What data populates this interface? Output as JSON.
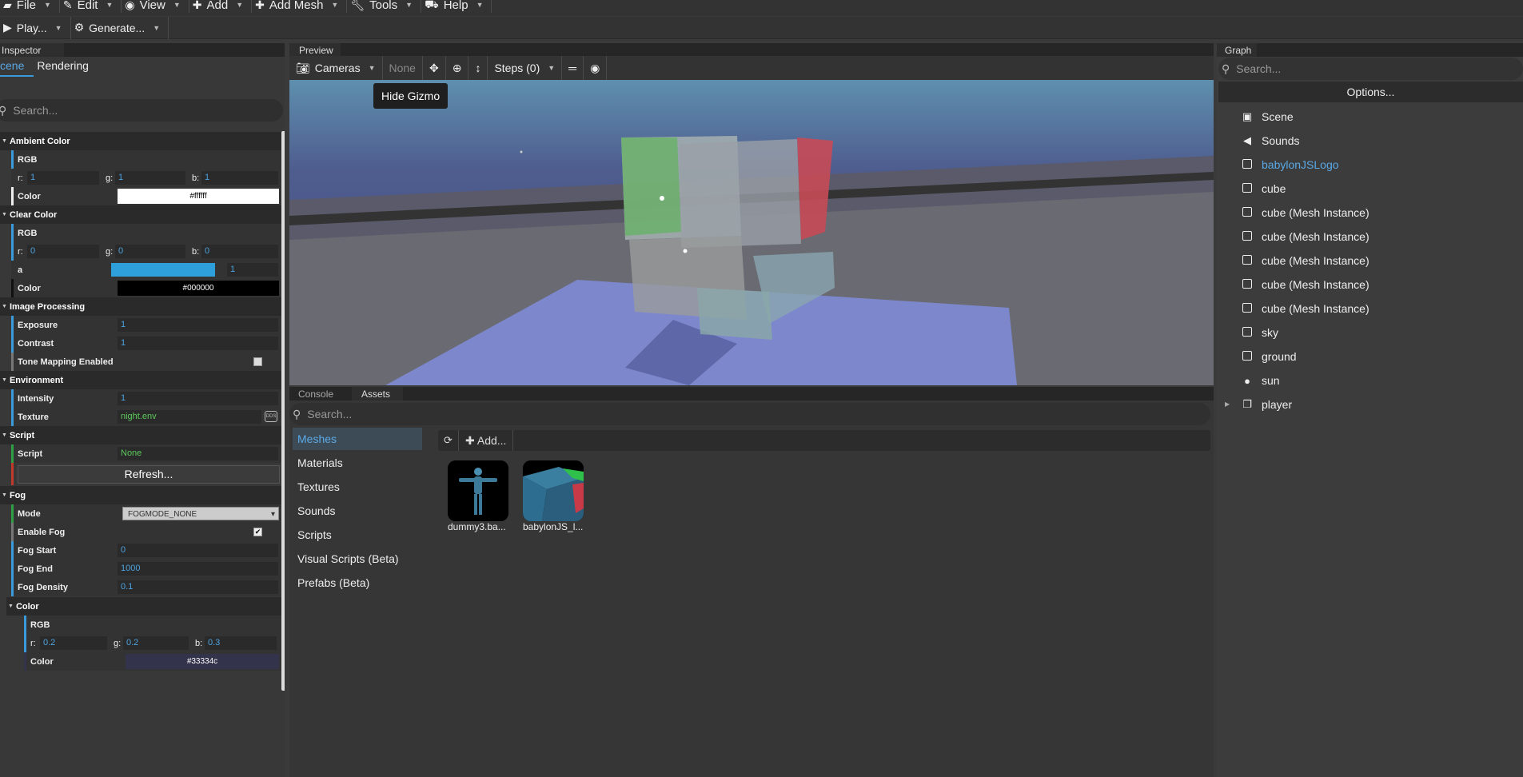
{
  "menubar": {
    "items": [
      {
        "label": "File",
        "icon": "folder-icon"
      },
      {
        "label": "Edit",
        "icon": "edit-icon"
      },
      {
        "label": "View",
        "icon": "eye-icon"
      },
      {
        "label": "Add",
        "icon": "plus-icon"
      },
      {
        "label": "Add Mesh",
        "icon": "plus-icon"
      },
      {
        "label": "Tools",
        "icon": "wrench-icon"
      },
      {
        "label": "Help",
        "icon": "help-icon"
      }
    ]
  },
  "toolbar": {
    "play_label": "Play...",
    "generate_label": "Generate..."
  },
  "inspector": {
    "tab_label": "Inspector",
    "tabs": [
      "cene",
      "Rendering"
    ],
    "search_placeholder": "Search...",
    "ambient": {
      "section": "Ambient Color",
      "rgb_label": "RGB",
      "r": "1",
      "g": "1",
      "b": "1",
      "color_label": "Color",
      "color_hex": "#ffffff"
    },
    "clear": {
      "section": "Clear Color",
      "rgb_label": "RGB",
      "r": "0",
      "g": "0",
      "b": "0",
      "a_label": "a",
      "a_value": "1",
      "color_label": "Color",
      "color_hex": "#000000"
    },
    "image_processing": {
      "section": "Image Processing",
      "exposure_label": "Exposure",
      "exposure": "1",
      "contrast_label": "Contrast",
      "contrast": "1",
      "tone_label": "Tone Mapping Enabled"
    },
    "environment": {
      "section": "Environment",
      "intensity_label": "Intensity",
      "intensity": "1",
      "texture_label": "Texture",
      "texture": "night.env"
    },
    "script": {
      "section": "Script",
      "script_label": "Script",
      "script_value": "None",
      "refresh_label": "Refresh..."
    },
    "fog": {
      "section": "Fog",
      "mode_label": "Mode",
      "mode_value": "FOGMODE_NONE",
      "enable_label": "Enable Fog",
      "start_label": "Fog Start",
      "start": "0",
      "end_label": "Fog End",
      "end": "1000",
      "density_label": "Fog Density",
      "density": "0.1",
      "color_section": "Color",
      "rgb_label": "RGB",
      "r": "0.2",
      "g": "0.2",
      "b": "0.3",
      "color_label": "Color",
      "color_hex": "#33334c"
    },
    "rgb_keys": {
      "r": "r:",
      "g": "g:",
      "b": "b:"
    }
  },
  "preview": {
    "tab_label": "Preview",
    "cameras_label": "Cameras",
    "none_label": "None",
    "steps_label": "Steps (0)",
    "tooltip": "Hide Gizmo"
  },
  "bottom": {
    "tabs": [
      "Console",
      "Assets"
    ],
    "search_placeholder": "Search...",
    "categories": [
      "Meshes",
      "Materials",
      "Textures",
      "Sounds",
      "Scripts",
      "Visual Scripts (Beta)",
      "Prefabs (Beta)"
    ],
    "add_label": "Add...",
    "assets": [
      "dummy3.ba...",
      "babylonJS_l..."
    ]
  },
  "graph": {
    "tab_label": "Graph",
    "search_placeholder": "Search...",
    "options_label": "Options...",
    "items": [
      {
        "label": "Scene",
        "icon": "scene-icon"
      },
      {
        "label": "Sounds",
        "icon": "speaker-icon"
      },
      {
        "label": "babylonJSLogo",
        "icon": "mesh-icon"
      },
      {
        "label": "cube",
        "icon": "mesh-icon"
      },
      {
        "label": "cube (Mesh Instance)",
        "icon": "mesh-icon"
      },
      {
        "label": "cube (Mesh Instance)",
        "icon": "mesh-icon"
      },
      {
        "label": "cube (Mesh Instance)",
        "icon": "mesh-icon"
      },
      {
        "label": "cube (Mesh Instance)",
        "icon": "mesh-icon"
      },
      {
        "label": "cube (Mesh Instance)",
        "icon": "mesh-icon"
      },
      {
        "label": "sky",
        "icon": "mesh-icon"
      },
      {
        "label": "ground",
        "icon": "mesh-icon"
      },
      {
        "label": "sun",
        "icon": "bulb-icon"
      },
      {
        "label": "player",
        "icon": "transform-node-icon"
      }
    ]
  },
  "colors": {
    "accent": "#3b9ad9",
    "bar_blue": "#3b9ad9",
    "bar_green": "#2f9e44",
    "bar_red": "#c0392b"
  }
}
